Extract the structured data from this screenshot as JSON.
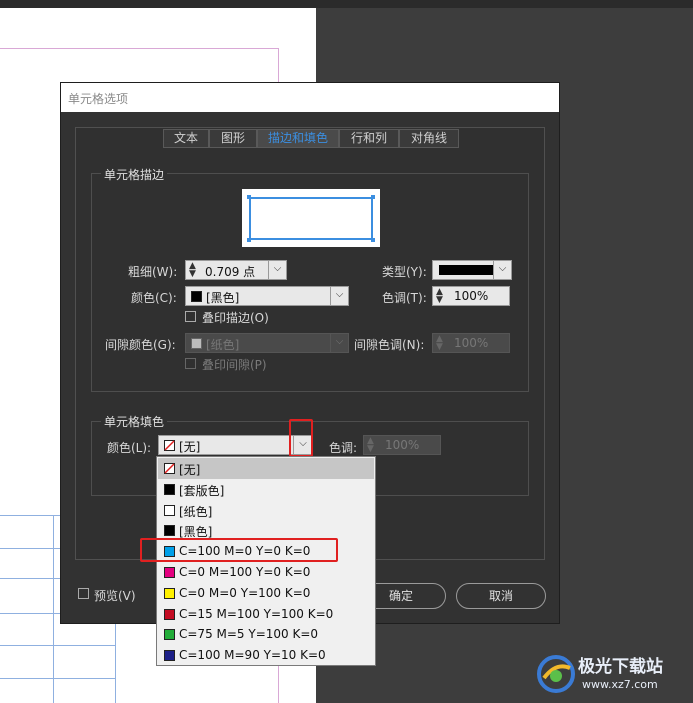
{
  "dialog": {
    "title": "单元格选项",
    "tabs": [
      "文本",
      "图形",
      "描边和填色",
      "行和列",
      "对角线"
    ],
    "active_tab": "描边和填色"
  },
  "stroke": {
    "group_title": "单元格描边",
    "weight_label": "粗细(W):",
    "weight_value": "0.709 点",
    "type_label": "类型(Y):",
    "color_label": "颜色(C):",
    "color_value": "[黑色]",
    "tint_label": "色调(T):",
    "tint_value": "100%",
    "overprint_label": "叠印描边(O)",
    "gap_color_label": "间隙颜色(G):",
    "gap_color_value": "[纸色]",
    "gap_tint_label": "间隙色调(N):",
    "gap_tint_value": "100%",
    "gap_overprint_label": "叠印间隙(P)"
  },
  "fill": {
    "group_title": "单元格填色",
    "color_label": "颜色(L):",
    "color_value": "[无]",
    "tint_label": "色调:",
    "tint_value": "100%"
  },
  "swatch_list": [
    {
      "label": "[无]",
      "color": "none"
    },
    {
      "label": "[套版色]",
      "color": "#000000"
    },
    {
      "label": "[纸色]",
      "color": "#ffffff"
    },
    {
      "label": "[黑色]",
      "color": "#000000"
    },
    {
      "label": "C=100 M=0 Y=0 K=0",
      "color": "#00a0e9"
    },
    {
      "label": "C=0 M=100 Y=0 K=0",
      "color": "#e4007f"
    },
    {
      "label": "C=0 M=0 Y=100 K=0",
      "color": "#fff100"
    },
    {
      "label": "C=15 M=100 Y=100 K=0",
      "color": "#c30d23"
    },
    {
      "label": "C=75 M=5 Y=100 K=0",
      "color": "#22ac38"
    },
    {
      "label": "C=100 M=90 Y=10 K=0",
      "color": "#1d2088"
    }
  ],
  "buttons": {
    "preview_label": "预览(V)",
    "ok_label": "确定",
    "cancel_label": "取消"
  },
  "watermark": {
    "site_name": "极光下载站",
    "site_url": "www.xz7.com"
  },
  "colors": {
    "accent": "#3b8ee0",
    "highlight": "#e02020",
    "dialog_bg": "#323232"
  }
}
